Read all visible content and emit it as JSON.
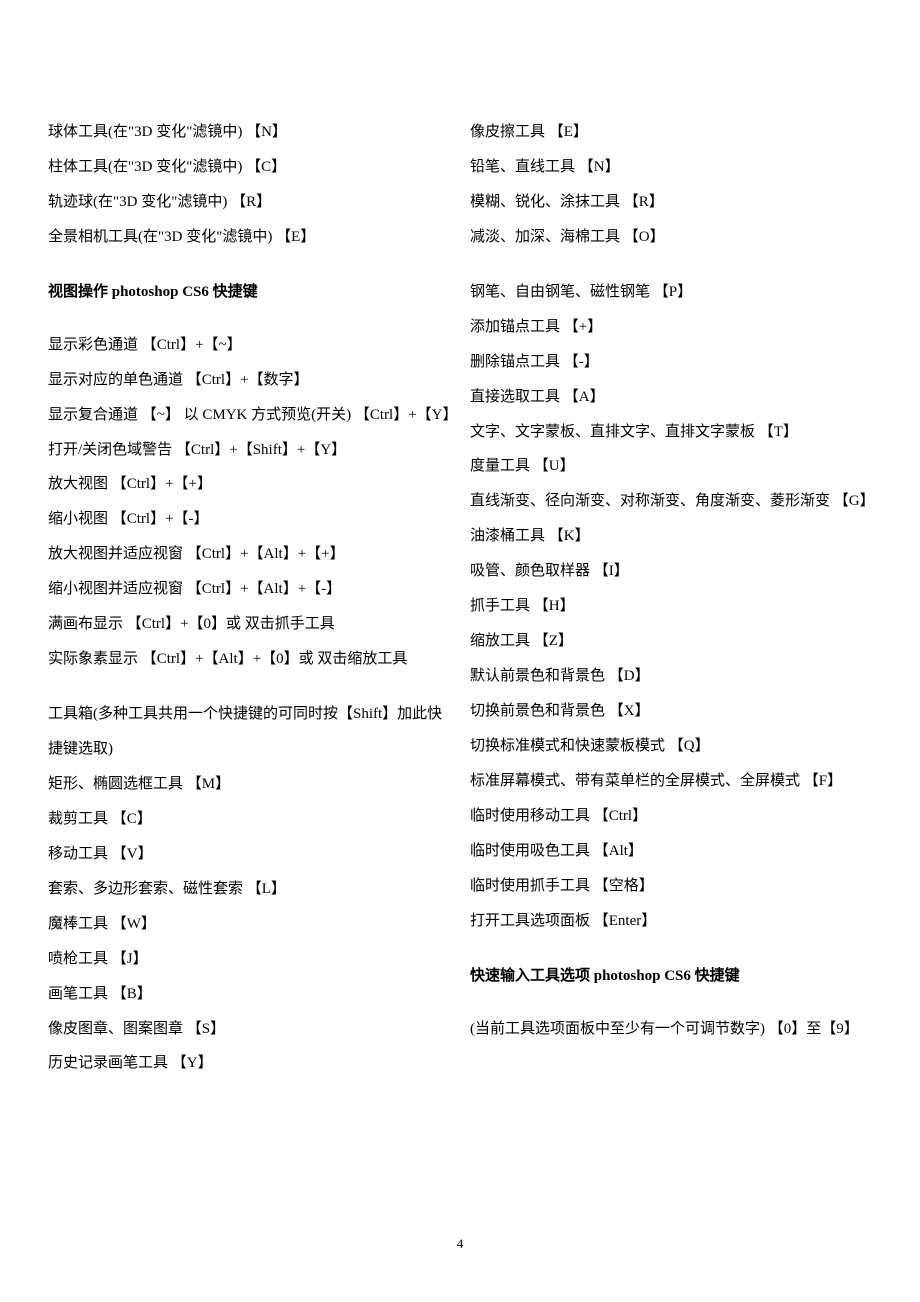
{
  "leftColumn": {
    "section1": [
      "球体工具(在\"3D 变化\"滤镜中) 【N】",
      "柱体工具(在\"3D 变化\"滤镜中) 【C】",
      "轨迹球(在\"3D 变化\"滤镜中) 【R】",
      "全景相机工具(在\"3D 变化\"滤镜中) 【E】"
    ],
    "heading1": "视图操作 photoshop CS6 快捷键",
    "section2": [
      "显示彩色通道 【Ctrl】+【~】",
      "显示对应的单色通道 【Ctrl】+【数字】",
      "显示复合通道 【~】 以 CMYK 方式预览(开关) 【Ctrl】+【Y】",
      "打开/关闭色域警告 【Ctrl】+【Shift】+【Y】",
      "放大视图 【Ctrl】+【+】",
      "缩小视图 【Ctrl】+【-】",
      "放大视图并适应视窗 【Ctrl】+【Alt】+【+】",
      "缩小视图并适应视窗 【Ctrl】+【Alt】+【-】",
      "满画布显示 【Ctrl】+【0】或 双击抓手工具",
      "实际象素显示 【Ctrl】+【Alt】+【0】或 双击缩放工具"
    ],
    "section3": [
      "工具箱(多种工具共用一个快捷键的可同时按【Shift】加此快捷键选取)",
      "矩形、椭圆选框工具 【M】",
      "裁剪工具 【C】",
      "移动工具 【V】",
      "套索、多边形套索、磁性套索 【L】",
      "魔棒工具 【W】",
      "喷枪工具 【J】",
      "画笔工具 【B】",
      "像皮图章、图案图章 【S】",
      "历史记录画笔工具 【Y】"
    ]
  },
  "rightColumn": {
    "section1": [
      "像皮擦工具 【E】",
      "铅笔、直线工具 【N】",
      "模糊、锐化、涂抹工具 【R】",
      "减淡、加深、海棉工具 【O】"
    ],
    "section2": [
      "钢笔、自由钢笔、磁性钢笔 【P】",
      "添加锚点工具 【+】",
      "删除锚点工具 【-】",
      "直接选取工具 【A】",
      "文字、文字蒙板、直排文字、直排文字蒙板 【T】",
      "度量工具 【U】",
      "直线渐变、径向渐变、对称渐变、角度渐变、菱形渐变 【G】",
      "油漆桶工具 【K】",
      "吸管、颜色取样器 【I】",
      "抓手工具 【H】",
      "缩放工具 【Z】",
      "默认前景色和背景色 【D】",
      "切换前景色和背景色 【X】",
      "切换标准模式和快速蒙板模式 【Q】",
      "标准屏幕模式、带有菜单栏的全屏模式、全屏模式 【F】",
      "临时使用移动工具 【Ctrl】",
      "临时使用吸色工具 【Alt】",
      "临时使用抓手工具 【空格】",
      "打开工具选项面板 【Enter】"
    ],
    "heading1": "快速输入工具选项  photoshop CS6 快捷键",
    "section3": [
      " (当前工具选项面板中至少有一个可调节数字) 【0】至【9】"
    ]
  },
  "pageNumber": "4"
}
